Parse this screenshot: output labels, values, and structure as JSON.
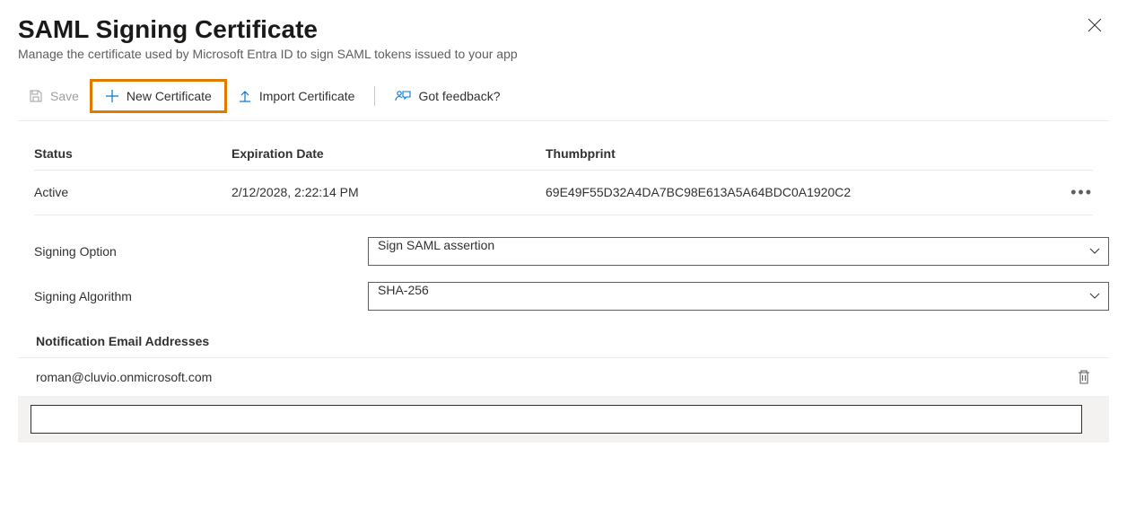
{
  "header": {
    "title": "SAML Signing Certificate",
    "subtitle": "Manage the certificate used by Microsoft Entra ID to sign SAML tokens issued to your app"
  },
  "toolbar": {
    "save": "Save",
    "new_cert": "New Certificate",
    "import_cert": "Import Certificate",
    "feedback": "Got feedback?"
  },
  "table": {
    "columns": {
      "status": "Status",
      "expiration": "Expiration Date",
      "thumbprint": "Thumbprint"
    },
    "rows": [
      {
        "status": "Active",
        "expiration": "2/12/2028, 2:22:14 PM",
        "thumbprint": "69E49F55D32A4DA7BC98E613A5A64BDC0A1920C2"
      }
    ]
  },
  "form": {
    "signing_option": {
      "label": "Signing Option",
      "value": "Sign SAML assertion"
    },
    "signing_algorithm": {
      "label": "Signing Algorithm",
      "value": "SHA-256"
    }
  },
  "emails": {
    "heading": "Notification Email Addresses",
    "list": [
      "roman@cluvio.onmicrosoft.com"
    ],
    "input_value": ""
  },
  "colors": {
    "highlight": "#e07b00",
    "link": "#0078d4"
  }
}
